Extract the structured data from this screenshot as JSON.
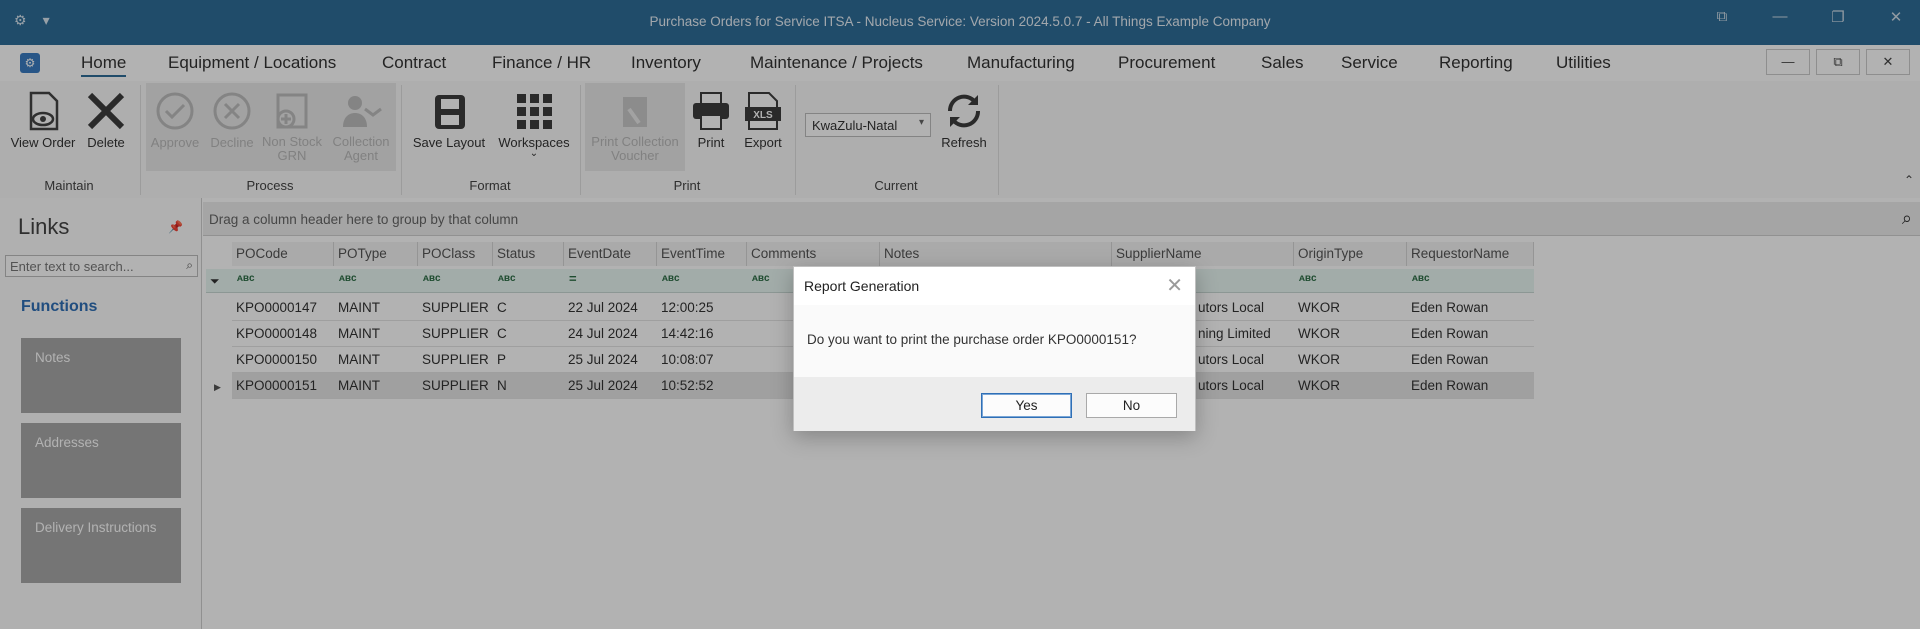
{
  "titlebar": {
    "title": "Purchase Orders for Service ITSA - Nucleus Service: Version 2024.5.0.7 - All Things Example Company",
    "app_menu_glyph": "⚙",
    "dropdown_glyph": "▾",
    "restore_glyph": "⧉",
    "minimize_glyph": "—",
    "maximize_glyph": "❐",
    "close_glyph": "✕"
  },
  "tabs": [
    {
      "label": "Home",
      "active": true
    },
    {
      "label": "Equipment / Locations"
    },
    {
      "label": "Contract"
    },
    {
      "label": "Finance / HR"
    },
    {
      "label": "Inventory"
    },
    {
      "label": "Maintenance / Projects"
    },
    {
      "label": "Manufacturing"
    },
    {
      "label": "Procurement"
    },
    {
      "label": "Sales"
    },
    {
      "label": "Service"
    },
    {
      "label": "Reporting"
    },
    {
      "label": "Utilities"
    }
  ],
  "window_controls": {
    "minimize": "—",
    "restore": "⧉",
    "close": "✕"
  },
  "ribbon": {
    "view_order": "View Order",
    "delete": "Delete",
    "approve": "Approve",
    "decline": "Decline",
    "non_stock_grn": "Non Stock GRN",
    "collection_agent": "Collection Agent",
    "save_layout": "Save Layout",
    "workspaces": "Workspaces",
    "print_collection_voucher": "Print Collection Voucher",
    "print": "Print",
    "export": "Export",
    "region_value": "KwaZulu-Natal",
    "refresh": "Refresh",
    "groups": {
      "maintain": "Maintain",
      "process": "Process",
      "format": "Format",
      "print": "Print",
      "current": "Current"
    }
  },
  "links_pane": {
    "title": "Links",
    "search_placeholder": "Enter text to search...",
    "functions_label": "Functions",
    "items": [
      "Notes",
      "Addresses",
      "Delivery Instructions"
    ]
  },
  "grid": {
    "group_hint": "Drag a column header here to group by that column",
    "columns": [
      "POCode",
      "POType",
      "POClass",
      "Status",
      "EventDate",
      "EventTime",
      "Comments",
      "Notes",
      "SupplierName",
      "OriginType",
      "RequestorName"
    ],
    "filter_glyph": "ᴀʙᴄ",
    "date_filter_glyph": "=",
    "rows": [
      {
        "POCode": "KPO0000147",
        "POType": "MAINT",
        "POClass": "SUPPLIER",
        "Status": "C",
        "EventDate": "22 Jul 2024",
        "EventTime": "12:00:25",
        "Supplier": "utors Local",
        "OriginType": "WKOR",
        "Requestor": "Eden Rowan"
      },
      {
        "POCode": "KPO0000148",
        "POType": "MAINT",
        "POClass": "SUPPLIER",
        "Status": "C",
        "EventDate": "24 Jul 2024",
        "EventTime": "14:42:16",
        "Supplier": "ning Limited",
        "OriginType": "WKOR",
        "Requestor": "Eden Rowan"
      },
      {
        "POCode": "KPO0000150",
        "POType": "MAINT",
        "POClass": "SUPPLIER",
        "Status": "P",
        "EventDate": "25 Jul 2024",
        "EventTime": "10:08:07",
        "Supplier": "utors Local",
        "OriginType": "WKOR",
        "Requestor": "Eden Rowan"
      },
      {
        "POCode": "KPO0000151",
        "POType": "MAINT",
        "POClass": "SUPPLIER",
        "Status": "N",
        "EventDate": "25 Jul 2024",
        "EventTime": "10:52:52",
        "Supplier": "utors Local",
        "OriginType": "WKOR",
        "Requestor": "Eden Rowan"
      }
    ]
  },
  "dialog": {
    "title": "Report Generation",
    "message": "Do you want to print the purchase order KPO0000151?",
    "yes": "Yes",
    "no": "No",
    "close_glyph": "✕"
  }
}
